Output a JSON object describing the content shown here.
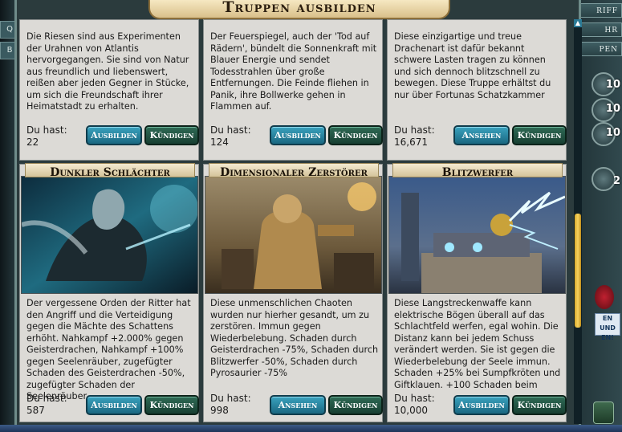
{
  "dialog": {
    "title": "Truppen ausbilden"
  },
  "side_left": [
    "Q",
    "B"
  ],
  "side_right": {
    "tabs": [
      "RIFF",
      "HR",
      "PEN"
    ],
    "badges": [
      "10",
      "10",
      "10",
      "2"
    ],
    "promo": "EN UND EN!"
  },
  "cards_top": [
    {
      "description": "Die Riesen sind aus Experimenten der Urahnen von Atlantis hervorgegangen. Sie sind von Natur aus freundlich und liebenswert, reißen aber jeden Gegner in Stücke, um sich die Freundschaft ihrer Heimatstadt zu erhalten.",
      "have_label": "Du hast:",
      "have_value": "22",
      "primary_label": "Ausbilden",
      "secondary_label": "Kündigen"
    },
    {
      "description": "Der Feuerspiegel, auch der 'Tod auf Rädern', bündelt die Sonnenkraft mit Blauer Energie und sendet Todesstrahlen über große Entfernungen. Die Feinde fliehen in Panik, ihre Bollwerke gehen in Flammen auf.",
      "have_label": "Du hast:",
      "have_value": "124",
      "primary_label": "Ausbilden",
      "secondary_label": "Kündigen"
    },
    {
      "description": "Diese einzigartige und treue Drachenart ist dafür bekannt schwere Lasten tragen zu können und sich dennoch blitzschnell zu bewegen. Diese Truppe erhältst du nur über Fortunas Schatzkammer",
      "have_label": "Du hast:",
      "have_value": "16,671",
      "primary_label": "Ansehen",
      "secondary_label": "Kündigen"
    }
  ],
  "cards_bottom": [
    {
      "name": "Dunkler Schlächter",
      "description": "Der vergessene Orden der Ritter hat den Angriff und die Verteidigung gegen die Mächte des Schattens erhöht. Nahkampf +2.000% gegen Geisterdrachen, Nahkampf +100% gegen Seelenräuber, zugefügter Schaden des Geisterdrachen -50%, zugefügter Schaden der Seelenräuber -",
      "have_label": "Du hast:",
      "have_value": "587",
      "primary_label": "Ausbilden",
      "secondary_label": "Kündigen"
    },
    {
      "name": "Dimensionaler Zerstörer",
      "description": "Diese unmenschlichen Chaoten wurden nur hierher gesandt, um zu zerstören. Immun gegen Wiederbelebung. Schaden durch Geisterdrachen -75%, Schaden durch Blitzwerfer -50%, Schaden durch Pyrosaurier -75%",
      "have_label": "Du hast:",
      "have_value": "998",
      "primary_label": "Ansehen",
      "secondary_label": "Kündigen"
    },
    {
      "name": "Blitzwerfer",
      "description": "Diese Langstreckenwaffe kann elektrische Bögen überall auf das Schlachtfeld werfen, egal wohin. Die Distanz kann bei jedem Schuss verändert werden. Sie ist gegen die Wiederbelebung der Seele immun. Schaden +25% bei Sumpfkröten und Giftklauen. +100 Schaden beim",
      "have_label": "Du hast:",
      "have_value": "10,000",
      "primary_label": "Ausbilden",
      "secondary_label": "Kündigen"
    }
  ]
}
